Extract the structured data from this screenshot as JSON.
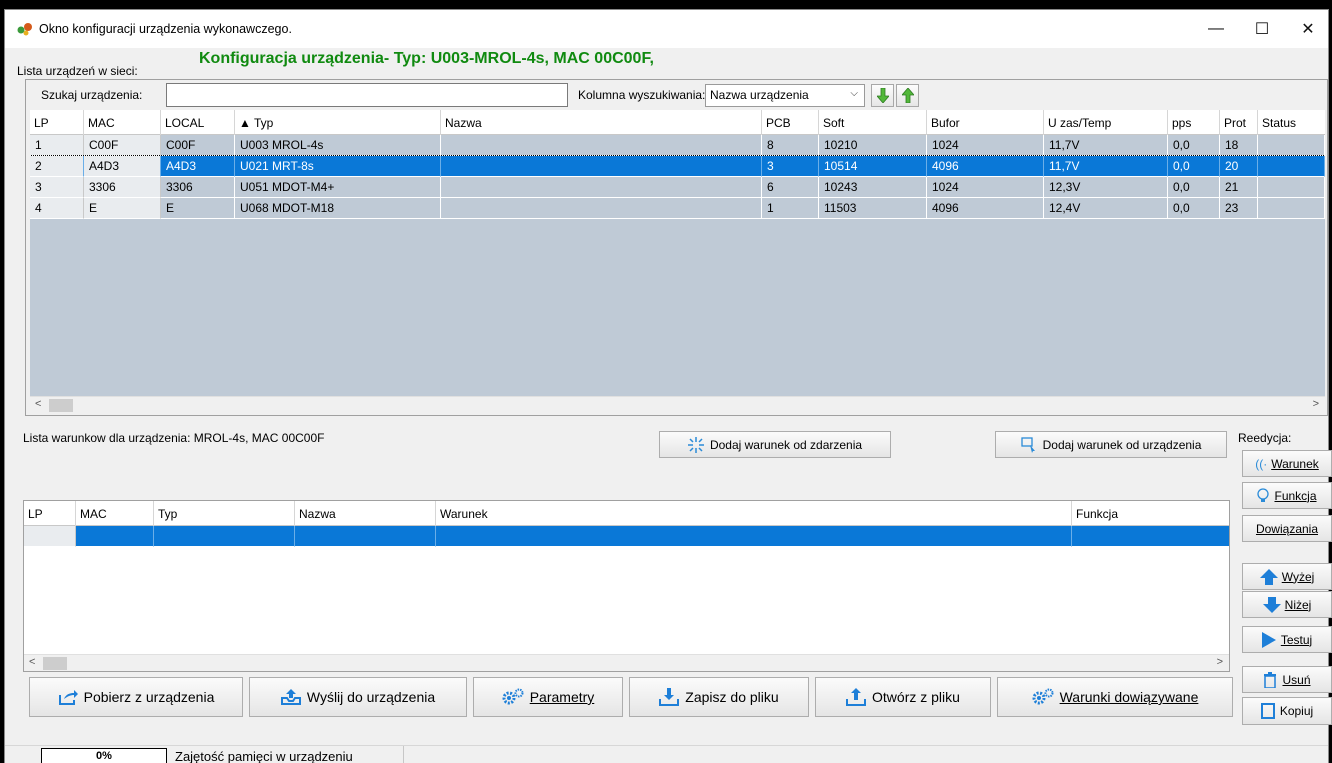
{
  "window": {
    "title": "Okno konfiguracji urządzenia wykonawczego.",
    "controls": {
      "minimize": "—",
      "maximize": "☐",
      "close": "✕"
    }
  },
  "device_list": {
    "label": "Lista urządzeń w sieci:",
    "config_title": "Konfiguracja urządzenia- Typ: U003-MROL-4s, MAC 00C00F,",
    "search_label": "Szukaj urządzenia:",
    "search_value": "",
    "column_label": "Kolumna wyszukiwania:",
    "column_value": "Nazwa urządzenia",
    "columns": [
      "LP",
      "MAC",
      "LOCAL",
      "▲ Typ",
      "Nazwa",
      "PCB",
      "Soft",
      "Bufor",
      "U zas/Temp",
      "pps",
      "Prot",
      "Status"
    ],
    "rows": [
      [
        "1",
        "C00F",
        "C00F",
        "U003 MROL-4s",
        "",
        "8",
        "10210",
        "1024",
        "11,7V",
        "0,0",
        "18",
        ""
      ],
      [
        "2",
        "A4D3",
        "A4D3",
        "U021 MRT-8s",
        "",
        "3",
        "10514",
        "4096",
        "11,7V",
        "0,0",
        "20",
        ""
      ],
      [
        "3",
        "3306",
        "3306",
        "U051 MDOT-M4+",
        "",
        "6",
        "10243",
        "1024",
        "12,3V",
        "0,0",
        "21",
        ""
      ],
      [
        "4",
        "E",
        "E",
        "U068 MDOT-M18",
        "",
        "1",
        "11503",
        "4096",
        "12,4V",
        "0,0",
        "23",
        ""
      ]
    ],
    "selected_row": 1
  },
  "conditions": {
    "label": "Lista warunkow dla urządzenia: MROL-4s, MAC 00C00F",
    "add_event_button": "Dodaj warunek od zdarzenia",
    "add_device_button": "Dodaj warunek od urządzenia",
    "columns": [
      "LP",
      "MAC",
      "Typ",
      "Nazwa",
      "Warunek",
      "Funkcja"
    ]
  },
  "side_panel": {
    "title": "Reedycja:",
    "warunek": "Warunek",
    "funkcja": "Funkcja",
    "dowiazania": "Dowiązania",
    "wyzej": "Wyżej",
    "nizej": "Niżej",
    "testuj": "Testuj",
    "usun": "Usuń",
    "kopiuj": "Kopiuj"
  },
  "bottom_buttons": {
    "pobierz": "Pobierz z urządzenia",
    "wyslij": "Wyślij do urządzenia",
    "parametry": "Parametry",
    "zapisz": "Zapisz do pliku",
    "otworz": "Otwórz z pliku",
    "warunki": "Warunki dowiązywane"
  },
  "status": {
    "memory_percent": "0%",
    "memory_label": "Zajętość pamięci w urządzeniu"
  },
  "colors": {
    "accent": "#0a78d7",
    "title_green": "#108a10",
    "grid_bg": "#bfcad6"
  }
}
